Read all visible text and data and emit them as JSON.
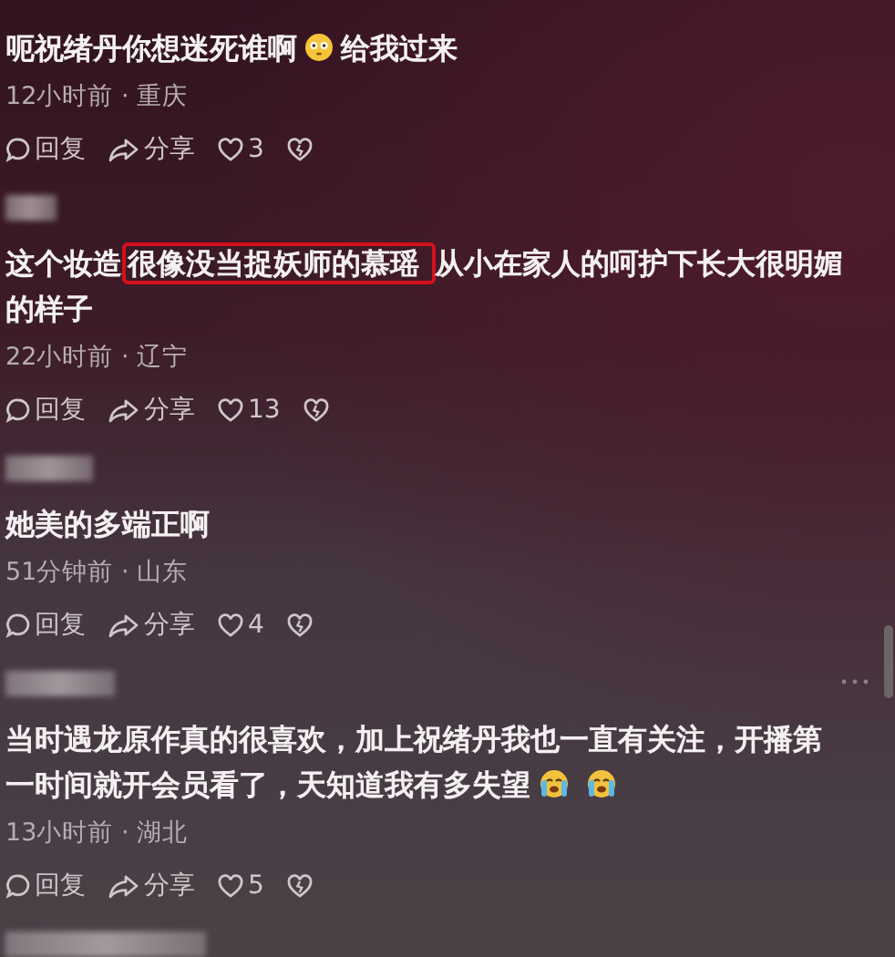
{
  "comments": [
    {
      "name_hidden": false,
      "more_menu": false,
      "segments": [
        {
          "kind": "text",
          "text": "呃祝绪丹你想迷死谁啊"
        },
        {
          "kind": "flushed"
        },
        {
          "kind": "text",
          "text": "给我过来"
        }
      ],
      "meta": "12小时前 · 重庆",
      "reply": "回复",
      "share": "分享",
      "likes": "3"
    },
    {
      "name_hidden": true,
      "more_menu": false,
      "segments": [
        {
          "kind": "text",
          "text": "这个妆造"
        },
        {
          "kind": "highlight",
          "text": "很像没当捉妖师的慕瑶 "
        },
        {
          "kind": "text",
          "text": "从小在家人的呵护下长大很明媚的样子"
        }
      ],
      "meta": "22小时前 · 辽宁",
      "reply": "回复",
      "share": "分享",
      "likes": "13"
    },
    {
      "name_hidden": true,
      "more_menu": false,
      "segments": [
        {
          "kind": "text",
          "text": "她美的多端正啊"
        }
      ],
      "meta": "51分钟前 · 山东",
      "reply": "回复",
      "share": "分享",
      "likes": "4"
    },
    {
      "name_hidden": true,
      "more_menu": true,
      "segments": [
        {
          "kind": "text",
          "text": "当时遇龙原作真的很喜欢，加上祝绪丹我也一直有关注，开播第一时间就开会员看了，天知道我有多失望"
        },
        {
          "kind": "crying"
        },
        {
          "kind": "crying"
        }
      ],
      "meta": "13小时前 · 湖北",
      "reply": "回复",
      "share": "分享",
      "likes": "5"
    }
  ],
  "next_name_hidden": true
}
